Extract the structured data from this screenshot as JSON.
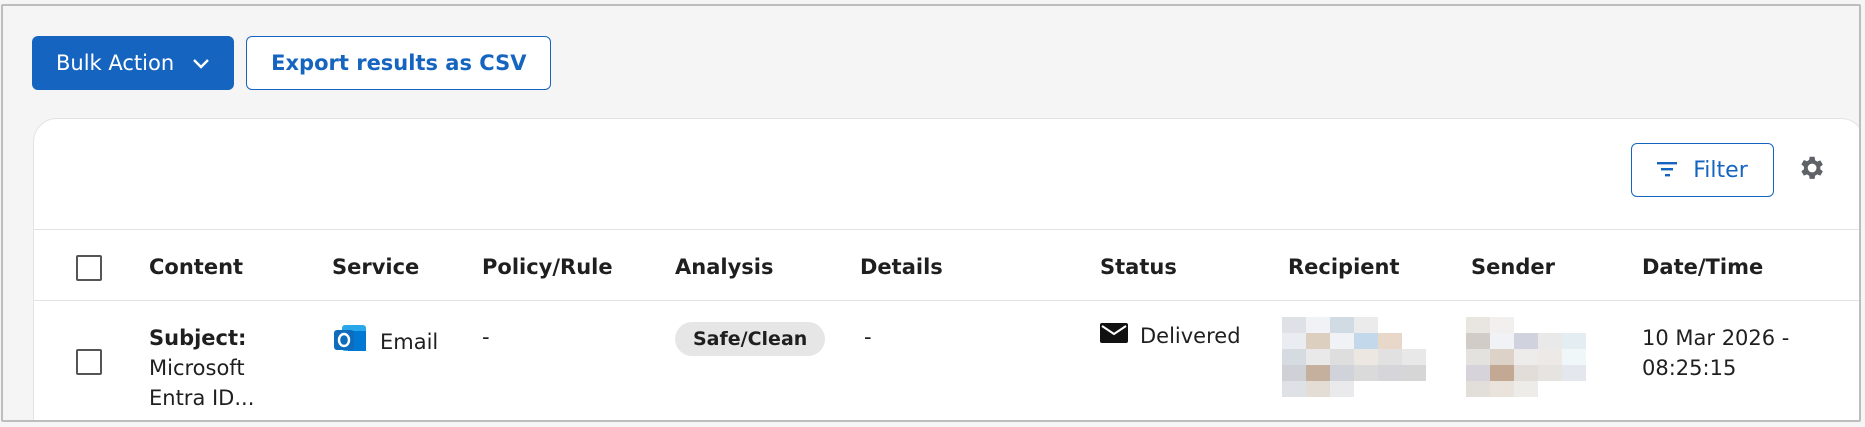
{
  "toolbar": {
    "bulk_action_label": "Bulk Action",
    "export_label": "Export results as CSV"
  },
  "panel": {
    "filter_label": "Filter"
  },
  "table": {
    "columns": [
      "Content",
      "Service",
      "Policy/Rule",
      "Analysis",
      "Details",
      "Status",
      "Recipient",
      "Sender",
      "Date/Time"
    ],
    "rows": [
      {
        "subject_label": "Subject:",
        "subject_line1": "Microsoft",
        "subject_line2": "Entra ID...",
        "service": "Email",
        "policy_rule": "-",
        "analysis": "Safe/Clean",
        "details": "-",
        "status": "Delivered",
        "date_line1": "10 Mar 2026 -",
        "date_line2": "08:25:15"
      }
    ]
  },
  "colors": {
    "accent": "#1565c0",
    "badge_bg": "#e6e6e6",
    "outlook_blue": "#0f6cbd"
  },
  "icons": {
    "bulk_chevron": "chevron-down-icon",
    "filter": "filter-icon",
    "settings": "gear-icon",
    "service": "outlook-icon",
    "status": "envelope-icon"
  }
}
